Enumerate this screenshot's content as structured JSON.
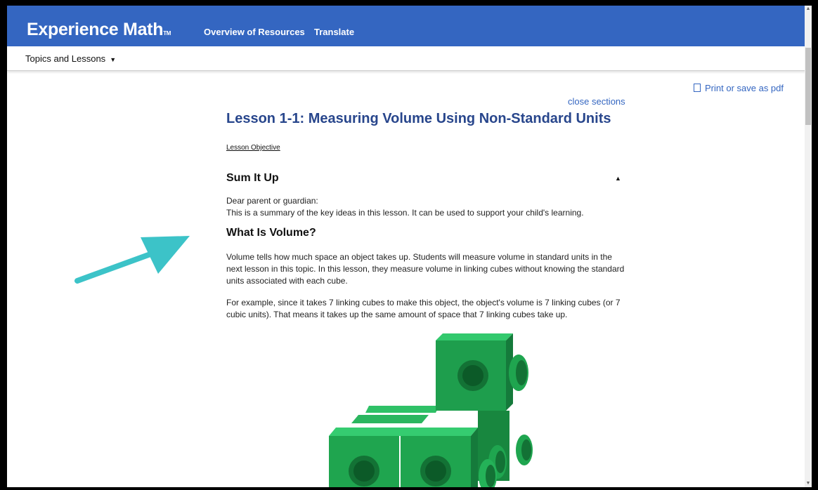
{
  "header": {
    "brand": "Experience Math",
    "brand_tm": "TM",
    "nav": [
      "Overview of Resources",
      "Translate"
    ]
  },
  "subnav": {
    "topics_label": "Topics and Lessons"
  },
  "content": {
    "print_label": "Print or save as pdf",
    "close_sections": "close sections",
    "lesson_title": "Lesson 1-1: Measuring Volume Using Non-Standard Units",
    "objective_link": "Lesson Objective",
    "sum_heading": "Sum It Up",
    "sum_line1": "Dear parent or guardian:",
    "sum_line2": "This is a summary of the key ideas in this lesson. It can be used to support your child's learning.",
    "volume_heading": "What Is Volume?",
    "volume_para1": "Volume tells how much space an object takes up. Students will measure volume in standard units in the next lesson in this topic. In this lesson, they measure volume in linking cubes without knowing the standard units associated with each cube.",
    "volume_para2": "For example, since it takes 7 linking cubes to make this object, the object's volume is 7 linking cubes (or 7 cubic units). That means it takes up the same amount of space that 7 linking cubes take up."
  },
  "colors": {
    "brand_blue": "#3466c1",
    "title_blue": "#28468c",
    "arrow_teal": "#3cc3c8",
    "cube_green": "#1fa54f"
  }
}
